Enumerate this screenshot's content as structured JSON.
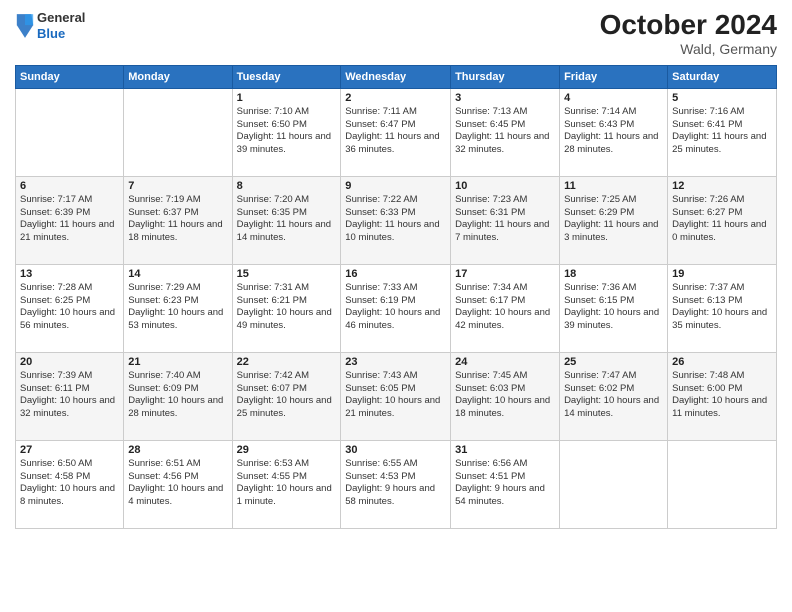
{
  "header": {
    "logo_line1": "General",
    "logo_line2": "Blue",
    "month": "October 2024",
    "location": "Wald, Germany"
  },
  "weekdays": [
    "Sunday",
    "Monday",
    "Tuesday",
    "Wednesday",
    "Thursday",
    "Friday",
    "Saturday"
  ],
  "weeks": [
    [
      {
        "day": "",
        "info": ""
      },
      {
        "day": "",
        "info": ""
      },
      {
        "day": "1",
        "info": "Sunrise: 7:10 AM\nSunset: 6:50 PM\nDaylight: 11 hours and 39 minutes."
      },
      {
        "day": "2",
        "info": "Sunrise: 7:11 AM\nSunset: 6:47 PM\nDaylight: 11 hours and 36 minutes."
      },
      {
        "day": "3",
        "info": "Sunrise: 7:13 AM\nSunset: 6:45 PM\nDaylight: 11 hours and 32 minutes."
      },
      {
        "day": "4",
        "info": "Sunrise: 7:14 AM\nSunset: 6:43 PM\nDaylight: 11 hours and 28 minutes."
      },
      {
        "day": "5",
        "info": "Sunrise: 7:16 AM\nSunset: 6:41 PM\nDaylight: 11 hours and 25 minutes."
      }
    ],
    [
      {
        "day": "6",
        "info": "Sunrise: 7:17 AM\nSunset: 6:39 PM\nDaylight: 11 hours and 21 minutes."
      },
      {
        "day": "7",
        "info": "Sunrise: 7:19 AM\nSunset: 6:37 PM\nDaylight: 11 hours and 18 minutes."
      },
      {
        "day": "8",
        "info": "Sunrise: 7:20 AM\nSunset: 6:35 PM\nDaylight: 11 hours and 14 minutes."
      },
      {
        "day": "9",
        "info": "Sunrise: 7:22 AM\nSunset: 6:33 PM\nDaylight: 11 hours and 10 minutes."
      },
      {
        "day": "10",
        "info": "Sunrise: 7:23 AM\nSunset: 6:31 PM\nDaylight: 11 hours and 7 minutes."
      },
      {
        "day": "11",
        "info": "Sunrise: 7:25 AM\nSunset: 6:29 PM\nDaylight: 11 hours and 3 minutes."
      },
      {
        "day": "12",
        "info": "Sunrise: 7:26 AM\nSunset: 6:27 PM\nDaylight: 11 hours and 0 minutes."
      }
    ],
    [
      {
        "day": "13",
        "info": "Sunrise: 7:28 AM\nSunset: 6:25 PM\nDaylight: 10 hours and 56 minutes."
      },
      {
        "day": "14",
        "info": "Sunrise: 7:29 AM\nSunset: 6:23 PM\nDaylight: 10 hours and 53 minutes."
      },
      {
        "day": "15",
        "info": "Sunrise: 7:31 AM\nSunset: 6:21 PM\nDaylight: 10 hours and 49 minutes."
      },
      {
        "day": "16",
        "info": "Sunrise: 7:33 AM\nSunset: 6:19 PM\nDaylight: 10 hours and 46 minutes."
      },
      {
        "day": "17",
        "info": "Sunrise: 7:34 AM\nSunset: 6:17 PM\nDaylight: 10 hours and 42 minutes."
      },
      {
        "day": "18",
        "info": "Sunrise: 7:36 AM\nSunset: 6:15 PM\nDaylight: 10 hours and 39 minutes."
      },
      {
        "day": "19",
        "info": "Sunrise: 7:37 AM\nSunset: 6:13 PM\nDaylight: 10 hours and 35 minutes."
      }
    ],
    [
      {
        "day": "20",
        "info": "Sunrise: 7:39 AM\nSunset: 6:11 PM\nDaylight: 10 hours and 32 minutes."
      },
      {
        "day": "21",
        "info": "Sunrise: 7:40 AM\nSunset: 6:09 PM\nDaylight: 10 hours and 28 minutes."
      },
      {
        "day": "22",
        "info": "Sunrise: 7:42 AM\nSunset: 6:07 PM\nDaylight: 10 hours and 25 minutes."
      },
      {
        "day": "23",
        "info": "Sunrise: 7:43 AM\nSunset: 6:05 PM\nDaylight: 10 hours and 21 minutes."
      },
      {
        "day": "24",
        "info": "Sunrise: 7:45 AM\nSunset: 6:03 PM\nDaylight: 10 hours and 18 minutes."
      },
      {
        "day": "25",
        "info": "Sunrise: 7:47 AM\nSunset: 6:02 PM\nDaylight: 10 hours and 14 minutes."
      },
      {
        "day": "26",
        "info": "Sunrise: 7:48 AM\nSunset: 6:00 PM\nDaylight: 10 hours and 11 minutes."
      }
    ],
    [
      {
        "day": "27",
        "info": "Sunrise: 6:50 AM\nSunset: 4:58 PM\nDaylight: 10 hours and 8 minutes."
      },
      {
        "day": "28",
        "info": "Sunrise: 6:51 AM\nSunset: 4:56 PM\nDaylight: 10 hours and 4 minutes."
      },
      {
        "day": "29",
        "info": "Sunrise: 6:53 AM\nSunset: 4:55 PM\nDaylight: 10 hours and 1 minute."
      },
      {
        "day": "30",
        "info": "Sunrise: 6:55 AM\nSunset: 4:53 PM\nDaylight: 9 hours and 58 minutes."
      },
      {
        "day": "31",
        "info": "Sunrise: 6:56 AM\nSunset: 4:51 PM\nDaylight: 9 hours and 54 minutes."
      },
      {
        "day": "",
        "info": ""
      },
      {
        "day": "",
        "info": ""
      }
    ]
  ]
}
